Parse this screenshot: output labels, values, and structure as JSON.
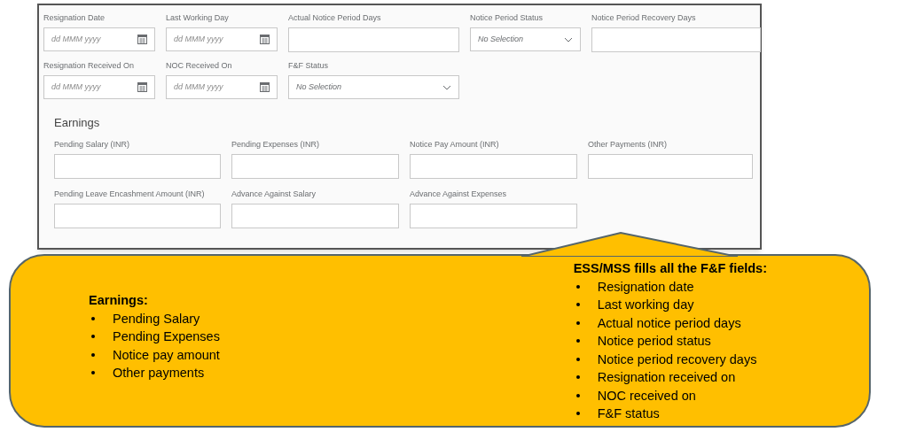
{
  "form": {
    "general_rows": [
      [
        {
          "kind": "date",
          "label": "Resignation Date",
          "placeholder": "dd MMM yyyy"
        },
        {
          "kind": "date",
          "label": "Last Working Day",
          "placeholder": "dd MMM yyyy"
        },
        {
          "kind": "text",
          "label": "Actual Notice Period Days"
        },
        {
          "kind": "select",
          "label": "Notice Period Status",
          "placeholder": "No Selection"
        },
        {
          "kind": "text",
          "label": "Notice Period Recovery Days"
        }
      ],
      [
        {
          "kind": "date",
          "label": "Resignation Received On",
          "placeholder": "dd MMM yyyy"
        },
        {
          "kind": "date",
          "label": "NOC Received On",
          "placeholder": "dd MMM yyyy"
        },
        {
          "kind": "select",
          "label": "F&F Status",
          "placeholder": "No Selection"
        }
      ]
    ],
    "earnings": {
      "title": "Earnings",
      "rows": [
        [
          {
            "kind": "text",
            "label": "Pending Salary (INR)"
          },
          {
            "kind": "text",
            "label": "Pending Expenses (INR)"
          },
          {
            "kind": "text",
            "label": "Notice Pay Amount (INR)"
          },
          {
            "kind": "text",
            "label": "Other Payments (INR)"
          }
        ],
        [
          {
            "kind": "text",
            "label": "Pending Leave Encashment Amount (INR)"
          },
          {
            "kind": "text",
            "label": "Advance Against Salary"
          },
          {
            "kind": "text",
            "label": "Advance Against Expenses"
          }
        ]
      ]
    }
  },
  "callout": {
    "left": {
      "heading": "Earnings:",
      "items": [
        "Pending Salary",
        "Pending Expenses",
        "Notice pay amount",
        "Other payments"
      ]
    },
    "right": {
      "heading": "ESS/MSS fills all the F&F fields:",
      "items": [
        "Resignation date",
        "Last working day",
        "Actual notice period days",
        "Notice period status",
        "Notice period recovery days",
        "Resignation received on",
        "NOC received on",
        "F&F status"
      ]
    }
  }
}
